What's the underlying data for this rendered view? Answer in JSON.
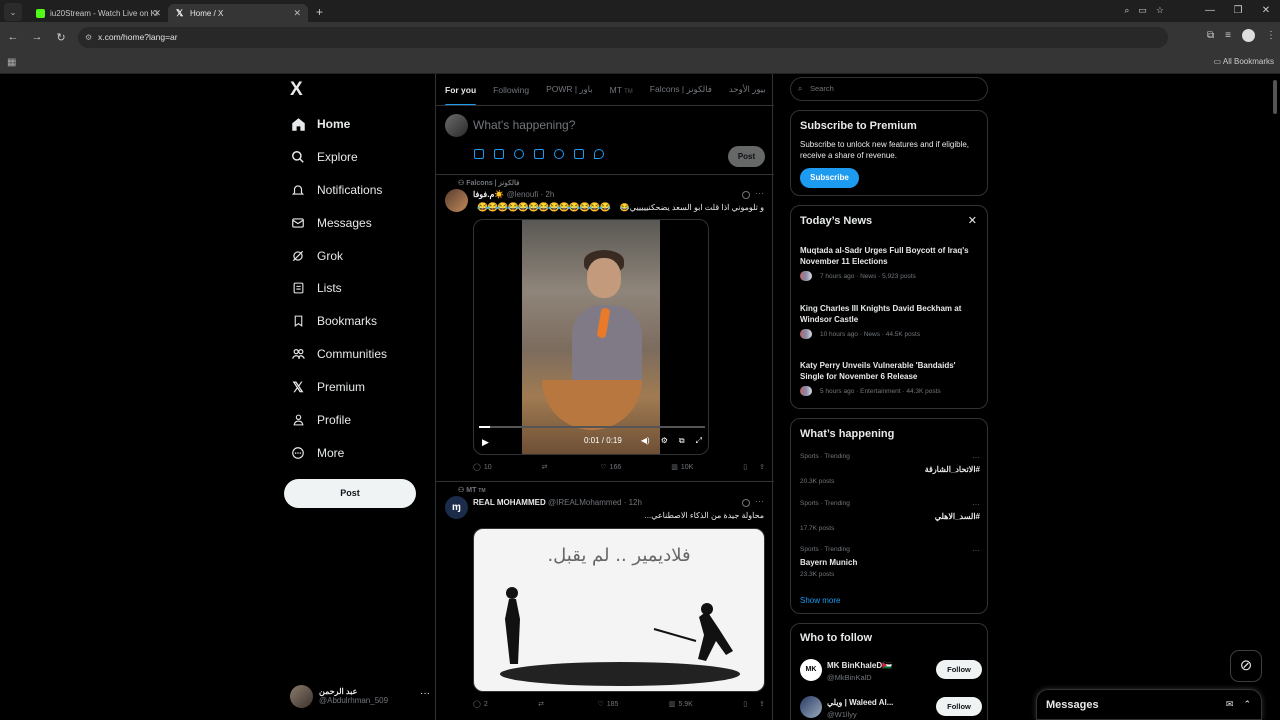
{
  "browser": {
    "tabs": [
      {
        "title": "iu20Stream - Watch Live on Ki",
        "favicon_color": "#53fc18"
      },
      {
        "title": "Home / X",
        "favicon_color": "#000000"
      }
    ],
    "url": "x.com/home?lang=ar",
    "bookmarks_label": "All Bookmarks"
  },
  "nav": {
    "logo": "X",
    "items": [
      {
        "label": "Home",
        "icon": "home-icon"
      },
      {
        "label": "Explore",
        "icon": "search-icon"
      },
      {
        "label": "Notifications",
        "icon": "bell-icon"
      },
      {
        "label": "Messages",
        "icon": "envelope-icon"
      },
      {
        "label": "Grok",
        "icon": "grok-icon"
      },
      {
        "label": "Lists",
        "icon": "list-icon"
      },
      {
        "label": "Bookmarks",
        "icon": "bookmark-icon"
      },
      {
        "label": "Communities",
        "icon": "people-icon"
      },
      {
        "label": "Premium",
        "icon": "x-icon"
      },
      {
        "label": "Profile",
        "icon": "person-icon"
      },
      {
        "label": "More",
        "icon": "more-circle-icon"
      }
    ],
    "post_button": "Post",
    "account": {
      "name": "عبد الرحمن",
      "handle": "@Abdulrhman_509"
    }
  },
  "feed": {
    "tabs": [
      {
        "label": "For you",
        "active": true
      },
      {
        "label": "Following"
      },
      {
        "label": "POWR | باور"
      },
      {
        "label": "MT",
        "tm": "TM"
      },
      {
        "label": "Falcons | فالكونز"
      },
      {
        "label": "بيور الأوحد"
      }
    ],
    "compose": {
      "placeholder": "What's happening?",
      "post_label": "Post"
    },
    "posts": [
      {
        "context": "Falcons | فالكونز",
        "name": "م.فوفا☀️",
        "handle": "@lenoufi",
        "time": "· 2h",
        "text": "و تلوموني اذا قلت ابو السعد يضحكنيييييي😂",
        "emoji_line": "😂😂😂😂😂😂😂😂😂😂😂😂😂",
        "video": {
          "current": "0:01",
          "duration": "0:19",
          "progress": 0.05
        },
        "replies": "10",
        "reposts": "",
        "likes": "166",
        "views": "10K"
      },
      {
        "context": "MT",
        "context_tm": "TM",
        "name": "REAL MOHAMMED",
        "handle": "@IREALMohammed",
        "time": "· 12h",
        "text": "محاولة جيدة من الذكاء الاصطناعي...",
        "image_caption": "فلاديمير .. لم يقبل.",
        "replies": "2",
        "reposts": "",
        "likes": "185",
        "views": "5.9K"
      }
    ]
  },
  "sidebar": {
    "search_placeholder": "Search",
    "premium": {
      "title": "Subscribe to Premium",
      "body": "Subscribe to unlock new features and if eligible, receive a share of revenue.",
      "button": "Subscribe"
    },
    "news": {
      "title": "Today’s News",
      "items": [
        {
          "headline": "Muqtada al-Sadr Urges Full Boycott of Iraq's November 11 Elections",
          "meta": "7 hours ago · News · 5,923 posts"
        },
        {
          "headline": "King Charles III Knights David Beckham at Windsor Castle",
          "meta": "10 hours ago · News · 44.5K posts"
        },
        {
          "headline": "Katy Perry Unveils Vulnerable 'Bandaids' Single for November 6 Release",
          "meta": "5 hours ago · Entertainment · 44.3K posts"
        }
      ]
    },
    "happening": {
      "title": "What’s happening",
      "trends": [
        {
          "category": "Sports · Trending",
          "name": "#الاتحاد_الشارقة",
          "posts": "20.3K posts",
          "rtl": true
        },
        {
          "category": "Sports · Trending",
          "name": "#السد_الاهلي",
          "posts": "17.7K posts",
          "rtl": true
        },
        {
          "category": "Sports · Trending",
          "name": "Bayern Munich",
          "posts": "23.3K posts",
          "rtl": false
        }
      ],
      "show_more": "Show more"
    },
    "who_to_follow": {
      "title": "Who to follow",
      "users": [
        {
          "name": "MK BinKhaleD🇯🇴",
          "handle": "@MkBinKalD",
          "button": "Follow"
        },
        {
          "name": "ويلي | Waleed Al...",
          "handle": "@W1llyy",
          "button": "Follow"
        }
      ]
    }
  },
  "messages_drawer": {
    "title": "Messages"
  }
}
